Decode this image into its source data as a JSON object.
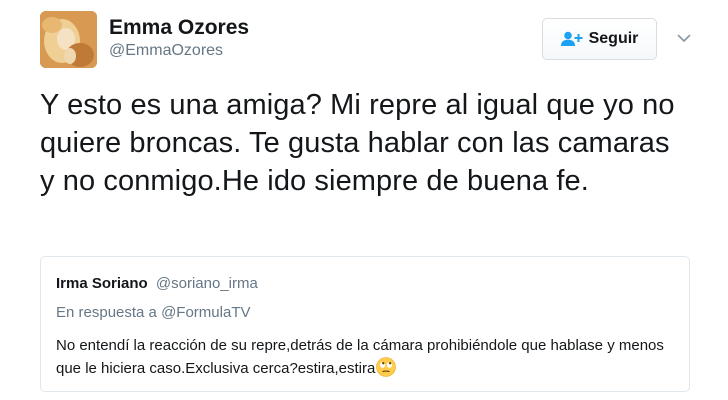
{
  "author": {
    "name": "Emma Ozores",
    "handle": "@EmmaOzores"
  },
  "follow_button": {
    "label": "Seguir",
    "icon": "add-user-icon"
  },
  "menu_icon": "chevron-down-icon",
  "tweet": {
    "text": "Y esto es una amiga? Mi repre al igual que yo no quiere broncas. Te gusta hablar con las camaras y no conmigo.He ido siempre de buena fe."
  },
  "quoted_tweet": {
    "author_name": "Irma Soriano",
    "author_handle": "@soriano_irma",
    "reply_prefix": "En respuesta a",
    "reply_to": "@FormulaTV",
    "text": "No entendí la reacción de su repre,detrás de la cámara prohibiéndole que hablase y menos que le hiciera caso.Exclusiva cerca?estira,estira",
    "emoji": "eye-roll-emoji"
  },
  "colors": {
    "primary_text": "#14171a",
    "secondary_text": "#657786",
    "accent": "#1da1f2",
    "border": "#e1e8ed"
  }
}
